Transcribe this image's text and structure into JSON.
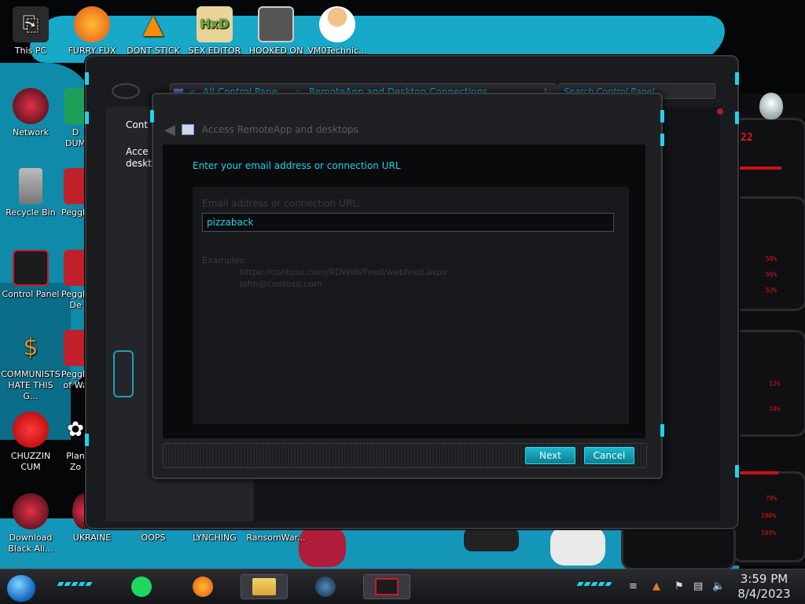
{
  "desktop_icons": {
    "this_pc": "This PC",
    "furry_fux": "FURRY FUX",
    "dont_stick": "DONT STICK",
    "sex_editor": "SEX EDITOR",
    "hooked_on": "HOOKED ON",
    "vm0": "VM0Technic...",
    "network": "Network",
    "dumb": "D\nDUM",
    "recycle_bin": "Recycle Bin",
    "peggle": "Peggle",
    "control_panel": "Control Panel",
    "peggle_de": "Peggle\nDe",
    "communists": "COMMUNISTS\nHATE THIS G...",
    "peggle_war": "Peggle\nof Wa",
    "chuzzin": "CHUZZIN\nCUM",
    "plants": "Plan\nZo",
    "download_black": "Download\nBlack Ali...",
    "ukraine": "UKRAINE",
    "oops": "OOPS",
    "lynching": "LYNCHING",
    "ransomware": "RansomWar..."
  },
  "control_panel": {
    "address_prefix": "«",
    "address_part1": "All Control Pane...",
    "address_sep": "›",
    "address_part2": "RemoteApp and Desktop Connections",
    "search_placeholder": "Search Control Panel",
    "side_link1": "Cont",
    "side_link2": "Acce\ndeskto"
  },
  "dialog": {
    "title": "Access RemoteApp and desktops",
    "heading": "Enter your email address or connection URL",
    "field_label": "Email address or connection URL:",
    "field_value": "pizzaback",
    "examples_title": "Examples:",
    "example1": "https://contoso.com/RDWeb/Feed/webfeed.aspx",
    "example2": "john@contoso.com",
    "next_label": "Next",
    "cancel_label": "Cancel"
  },
  "wallpaper_readouts": {
    "r1": "58%",
    "r2": "56%",
    "r3": "53%",
    "r4": "12%",
    "r5": "14%",
    "r6": "78%",
    "r7": "100%",
    "r8": "100%",
    "r9": "22"
  },
  "taskbar": {
    "time": "3:59 PM",
    "date": "8/4/2023"
  },
  "colors": {
    "accent_cyan": "#19d3ec",
    "wallpaper_blue": "#18a8c8",
    "alert_red": "#e0141e"
  },
  "icons": [
    "start-orb-icon",
    "spotify-icon",
    "firefox-icon",
    "file-explorer-icon",
    "steam-icon",
    "control-panel-icon",
    "shield-icon",
    "flag-icon",
    "network-icon",
    "volume-icon"
  ]
}
